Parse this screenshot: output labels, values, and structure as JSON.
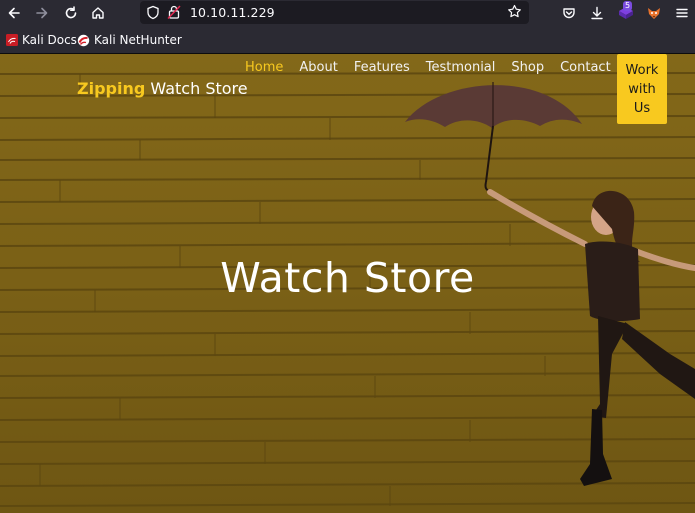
{
  "browser": {
    "url": "10.10.11.229",
    "extension_badge": "5",
    "bookmarks": [
      {
        "label": "Kali Docs",
        "icon": "kali-docs-icon"
      },
      {
        "label": "Kali NetHunter",
        "icon": "kali-nethunter-icon"
      }
    ]
  },
  "site": {
    "brand_strong": "Zipping",
    "brand_rest": "Watch Store",
    "nav": [
      "Home",
      "About",
      "Features",
      "Testmonial",
      "Shop",
      "Contact"
    ],
    "active_nav": "Home",
    "cta": "Work with Us",
    "hero_title": "Watch Store"
  },
  "colors": {
    "accent": "#f8c91f",
    "wall": "#7c6216",
    "chrome": "#2b2a33"
  }
}
